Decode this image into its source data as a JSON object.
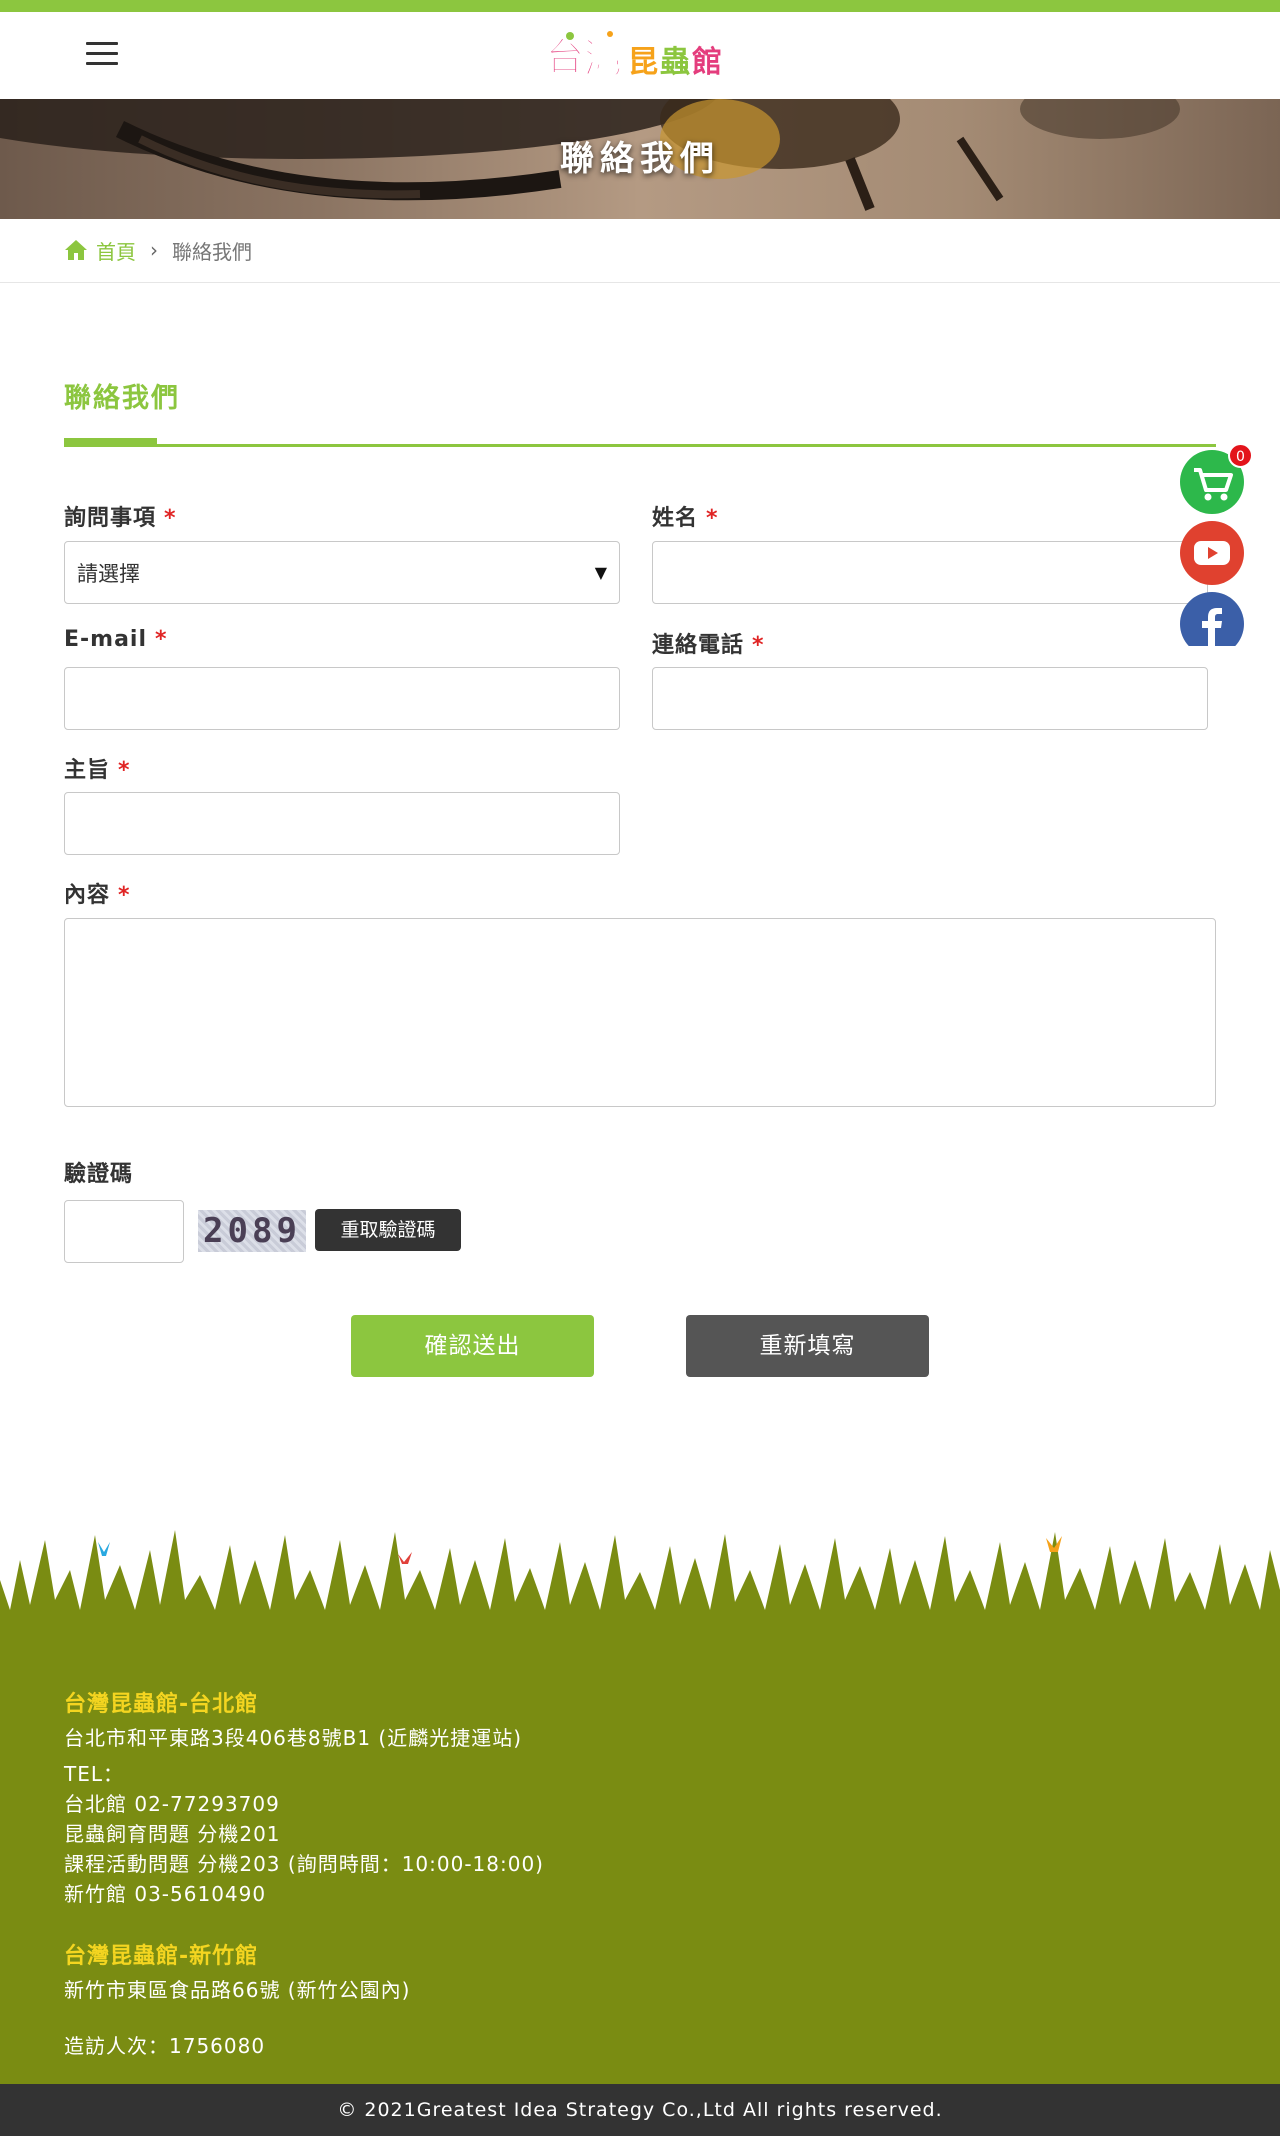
{
  "page": {
    "title": "聯絡我們"
  },
  "breadcrumb": {
    "home": "首頁",
    "separator": "›",
    "current": "聯絡我們"
  },
  "section": {
    "title": "聯絡我們"
  },
  "form": {
    "required_mark": "*",
    "inquiry": {
      "label": "詢問事項",
      "selected": "請選擇"
    },
    "name": {
      "label": "姓名",
      "value": ""
    },
    "email": {
      "label": "E-mail",
      "value": ""
    },
    "phone": {
      "label": "連絡電話",
      "value": ""
    },
    "subject": {
      "label": "主旨",
      "value": ""
    },
    "content": {
      "label": "內容",
      "value": ""
    },
    "captcha": {
      "label": "驗證碼",
      "code": "2089",
      "refresh_label": "重取驗證碼"
    },
    "submit_label": "確認送出",
    "reset_label": "重新填寫"
  },
  "floating": {
    "cart_count": "0",
    "icons": [
      "cart-icon",
      "youtube-icon",
      "facebook-icon"
    ]
  },
  "footer": {
    "taipei": {
      "title": "台灣昆蟲館-台北館",
      "address": "台北市和平東路3段406巷8號B1 (近麟光捷運站)",
      "tel_label": "TEL：",
      "tel_line": "台北館 02-77293709",
      "ext1": "昆蟲飼育問題 分機201",
      "ext2": "課程活動問題 分機203 (詢問時間：10:00-18:00)",
      "hsinchu_tel": "新竹館 03-5610490"
    },
    "hsinchu": {
      "title": "台灣昆蟲館-新竹館",
      "address": "新竹市東區食品路66號 (新竹公園內)"
    },
    "visitors": "造訪人次：1756080"
  },
  "copyright": "© 2021Greatest Idea Strategy Co.,Ltd All rights reserved.",
  "colors": {
    "brand_green": "#8cc63f",
    "footer_olive": "#7a8c12",
    "footer_heading": "#f4d520",
    "required": "#e02424"
  }
}
